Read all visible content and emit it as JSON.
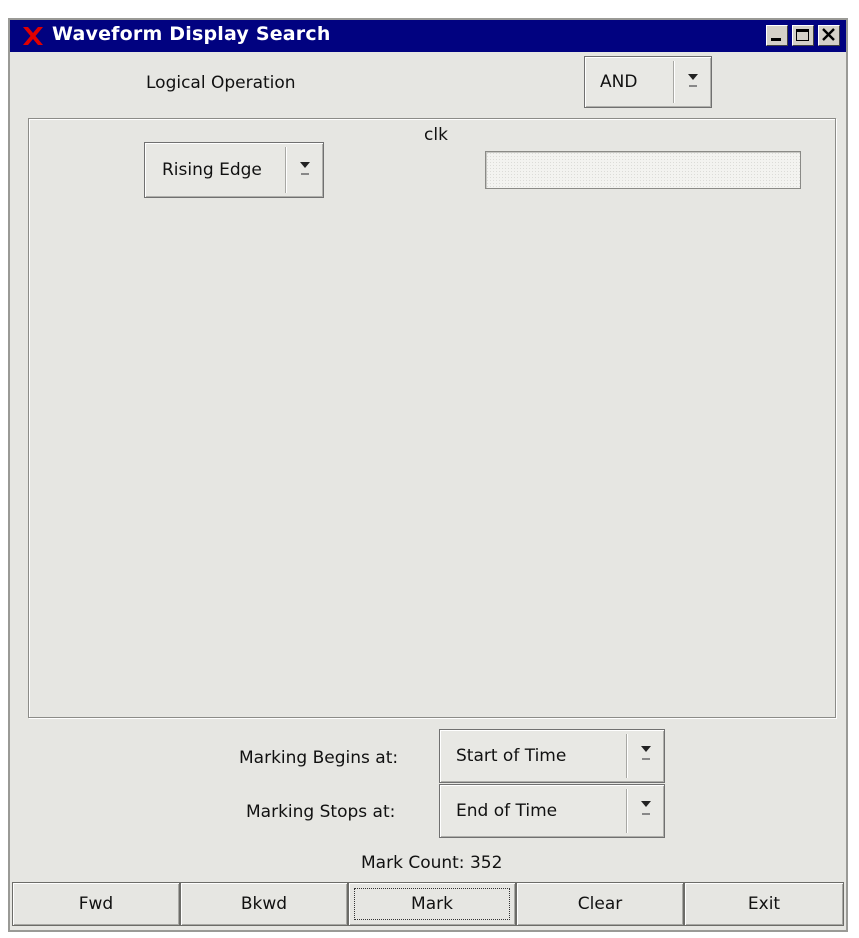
{
  "window": {
    "title": "Waveform Display Search"
  },
  "logical_operation": {
    "label": "Logical Operation",
    "selected": "AND"
  },
  "signal": {
    "name": "clk",
    "condition": "Rising Edge",
    "value": ""
  },
  "marking": {
    "begins_label": "Marking Begins at:",
    "begins_value": "Start of Time",
    "stops_label": "Marking Stops at:",
    "stops_value": "End of Time",
    "count_label": "Mark Count: 352"
  },
  "buttons": {
    "fwd": "Fwd",
    "bkwd": "Bkwd",
    "mark": "Mark",
    "clear": "Clear",
    "exit": "Exit"
  },
  "colors": {
    "titlebar": "#010280",
    "window_bg": "#e6e6e2",
    "x_logo": "#e00000"
  }
}
